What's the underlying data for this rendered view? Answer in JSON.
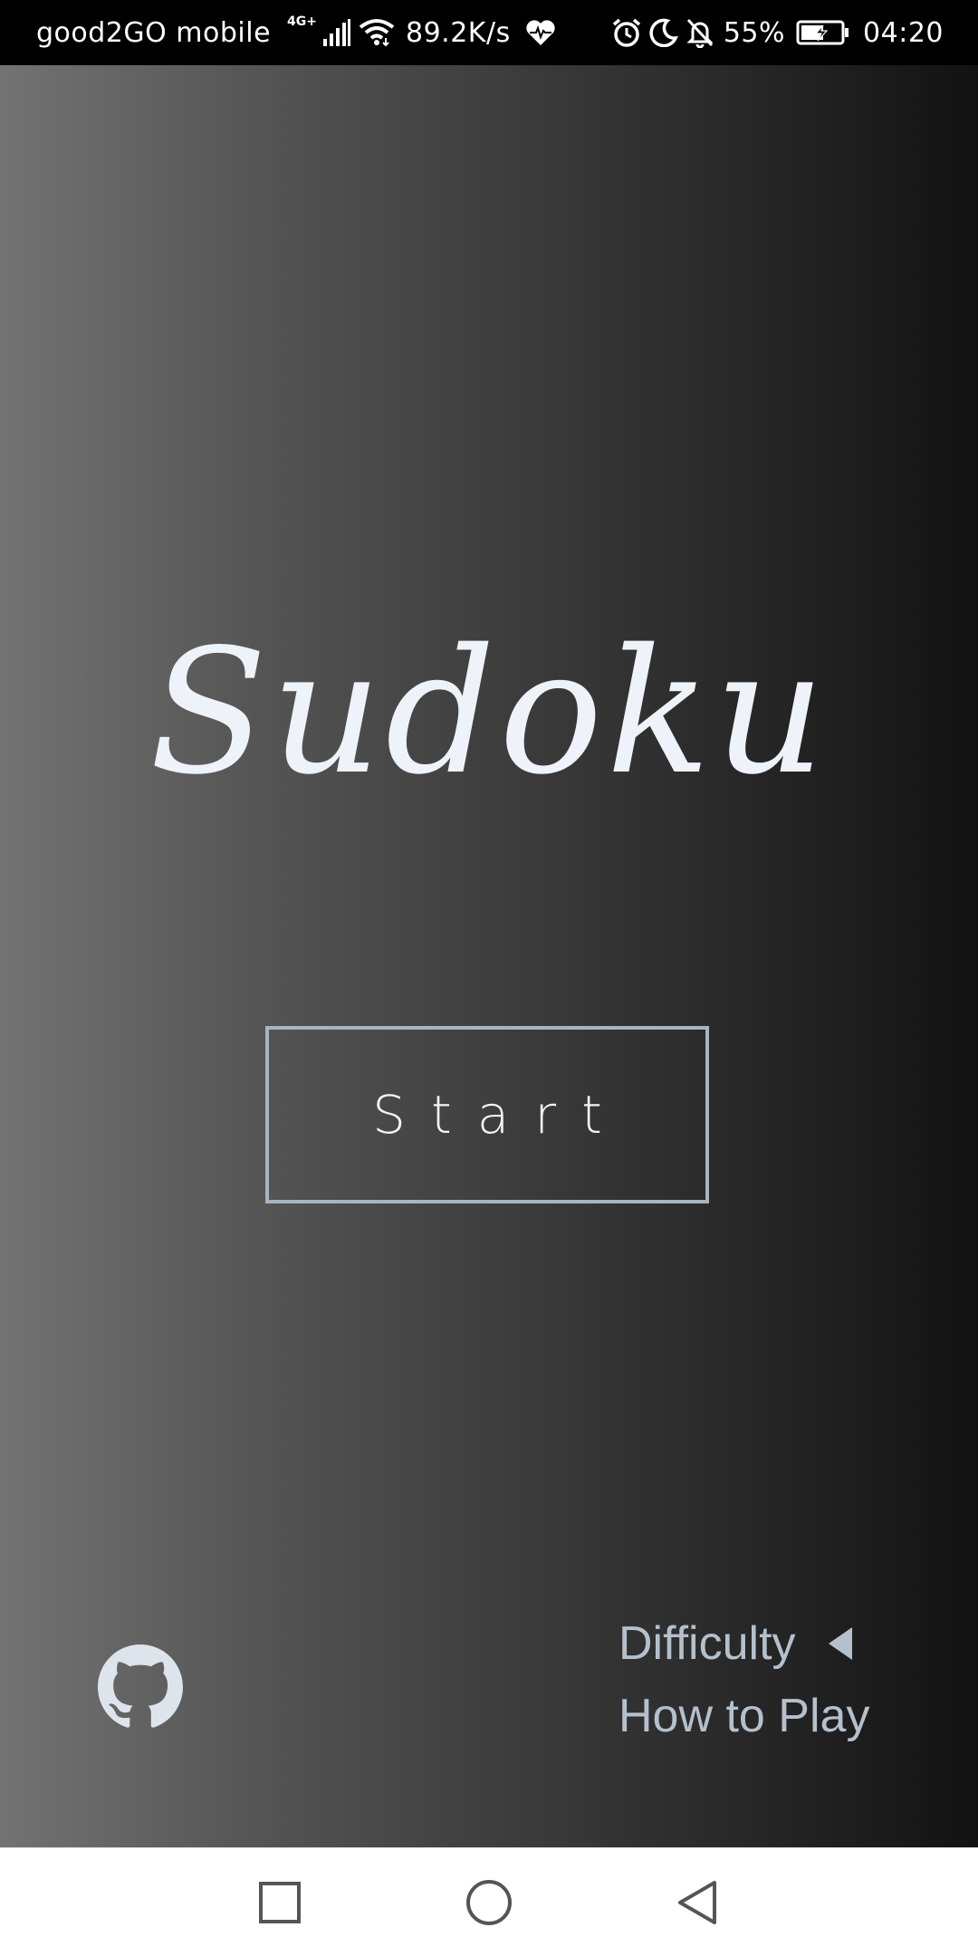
{
  "status_bar": {
    "carrier": "good2GO mobile",
    "network_type": "4G+",
    "network_speed": "89.2K/s",
    "battery_percent": "55%",
    "time": "04:20",
    "icons": [
      "signal-icon",
      "wifi-icon",
      "health-icon",
      "alarm-icon",
      "moon-icon",
      "bell-off-icon",
      "battery-icon"
    ]
  },
  "app": {
    "title": "Sudoku",
    "start_label": "Start",
    "menu": {
      "difficulty_label": "Difficulty",
      "how_to_play_label": "How to Play"
    },
    "github_icon": "github-icon"
  },
  "nav_bar": {
    "buttons": [
      "recents-icon",
      "home-icon",
      "back-icon"
    ]
  },
  "colors": {
    "title": "#eef3f9",
    "accent": "#a8b4c2",
    "menu_text": "#b4c0cd",
    "gradient_left": "#737373",
    "gradient_right": "#121212",
    "status_bar_bg": "#000000",
    "nav_bar_bg": "#ffffff"
  }
}
